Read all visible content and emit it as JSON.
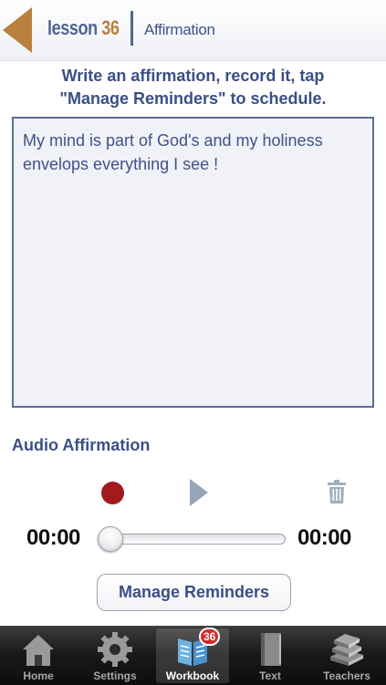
{
  "header": {
    "brand_word": "lesson",
    "brand_number": "36",
    "title": "Affirmation"
  },
  "instructions": {
    "line1": "Write an affirmation, record it, tap",
    "line2": "\"Manage Reminders\" to schedule."
  },
  "affirmation": {
    "text": "My mind is part of God's and my holiness envelops everything I see !"
  },
  "audio": {
    "heading": "Audio Affirmation",
    "elapsed": "00:00",
    "duration": "00:00",
    "progress": 0
  },
  "reminders_button": "Manage Reminders",
  "tab_bar": {
    "tabs": [
      {
        "label": "Home",
        "icon": "home-icon"
      },
      {
        "label": "Settings",
        "icon": "gear-icon"
      },
      {
        "label": "Workbook",
        "icon": "workbook-icon",
        "badge": "36",
        "active": true
      },
      {
        "label": "Text",
        "icon": "book-icon"
      },
      {
        "label": "Teachers",
        "icon": "books-stack-icon"
      }
    ]
  },
  "colors": {
    "accent": "#3b4f87",
    "brand_number": "#b9813d",
    "record": "#a31a1c",
    "back_arrow": "#b9813d"
  }
}
